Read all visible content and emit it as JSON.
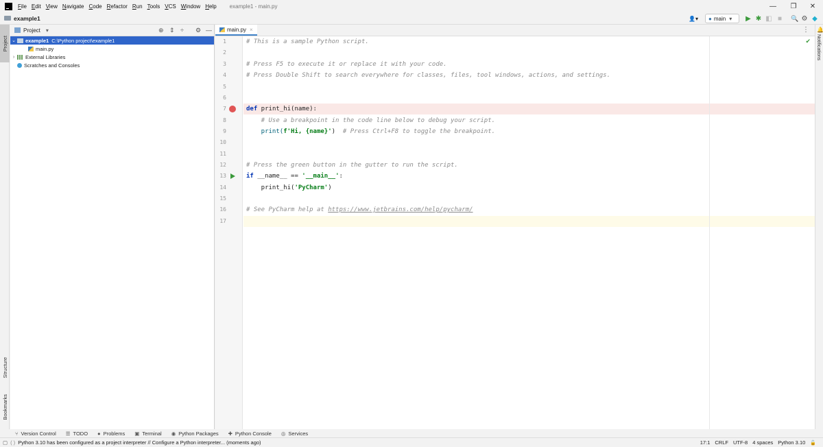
{
  "menu": [
    "File",
    "Edit",
    "View",
    "Navigate",
    "Code",
    "Refactor",
    "Run",
    "Tools",
    "VCS",
    "Window",
    "Help"
  ],
  "window_title": "example1 - main.py",
  "window_controls": {
    "minimize": "—",
    "restore": "❐",
    "close": "✕"
  },
  "navbar": {
    "project": "example1"
  },
  "toolbar": {
    "run_config": "main",
    "run_config_arrow": "▾",
    "user_icon": "👤▾",
    "run": "▶",
    "debug": "✱",
    "coverage": "◧",
    "stop": "■",
    "search": "🔍",
    "settings": "⚙",
    "logo": "◆"
  },
  "left_strip": {
    "project": "Project",
    "structure": "Structure",
    "bookmarks": "Bookmarks"
  },
  "right_strip": {
    "notifications": "Notifications"
  },
  "project_panel": {
    "title": "Project",
    "dropdown": "▾",
    "actions": {
      "locate": "⊕",
      "expand": "⇕",
      "collapse": "÷",
      "settings": "⚙",
      "hide": "—"
    },
    "tree": [
      {
        "label": "example1",
        "path": "C:\\Python project\\example1",
        "chevron": "⌄"
      },
      {
        "label": "main.py"
      },
      {
        "label": "External Libraries",
        "chevron": "›"
      },
      {
        "label": "Scratches and Consoles"
      }
    ]
  },
  "editor": {
    "tab": {
      "label": "main.py",
      "close": "×"
    },
    "inspection": "✔",
    "menu": "⋮",
    "line_numbers": [
      "1",
      "2",
      "3",
      "4",
      "5",
      "6",
      "7",
      "8",
      "9",
      "10",
      "11",
      "12",
      "13",
      "14",
      "15",
      "16",
      "17"
    ],
    "lines": {
      "l1": "# This is a sample Python script.",
      "l3": "# Press F5 to execute it or replace it with your code.",
      "l4": "# Press Double Shift to search everywhere for classes, files, tool windows, actions, and settings.",
      "l7_kw": "def",
      "l7_rest": " print_hi(name):",
      "l8": "    # Use a breakpoint in the code line below to debug your script.",
      "l9_a": "    print(",
      "l9_str": "f'Hi, {name}'",
      "l9_b": ")  ",
      "l9_cm": "# Press Ctrl+F8 to toggle the breakpoint.",
      "l12": "# Press the green button in the gutter to run the script.",
      "l13_kw": "if",
      "l13_a": " __name__ == ",
      "l13_str": "'__main__'",
      "l13_b": ":",
      "l14_a": "    print_hi(",
      "l14_str": "'PyCharm'",
      "l14_b": ")",
      "l16_cm": "# See PyCharm help at ",
      "l16_link": "https://www.jetbrains.com/help/pycharm/"
    }
  },
  "bottom_tabs": [
    {
      "icon": "⑂",
      "label": "Version Control"
    },
    {
      "icon": "☰",
      "label": "TODO"
    },
    {
      "icon": "●",
      "label": "Problems"
    },
    {
      "icon": "▣",
      "label": "Terminal"
    },
    {
      "icon": "◉",
      "label": "Python Packages"
    },
    {
      "icon": "✚",
      "label": "Python Console"
    },
    {
      "icon": "◎",
      "label": "Services"
    }
  ],
  "status": {
    "message": "Python 3.10 has been configured as a project interpreter // Configure a Python interpreter... (moments ago)",
    "position": "17:1",
    "line_sep": "CRLF",
    "encoding": "UTF-8",
    "indent": "4 spaces",
    "interpreter": "Python 3.10",
    "lock": "🔓"
  },
  "colors": {
    "accent": "#2f65ca",
    "breakpoint": "#e05555",
    "run": "#3b9a3b"
  }
}
